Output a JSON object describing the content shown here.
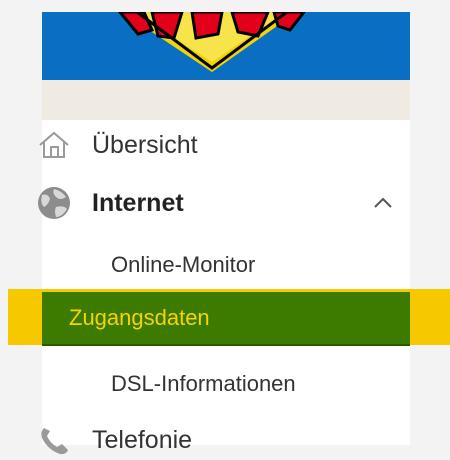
{
  "nav": {
    "overview_label": "Übersicht",
    "internet_label": "Internet",
    "telephony_label": "Telefonie",
    "internet_sub": [
      {
        "label": "Online-Monitor"
      },
      {
        "label": "Zugangsdaten"
      },
      {
        "label": "DSL-Informationen"
      }
    ]
  },
  "icons": {
    "overview": "home-icon",
    "internet": "globe-icon",
    "internet_toggle": "chevron-up-icon",
    "telephony": "phone-icon"
  },
  "colors": {
    "header_blue": "#0a6fc2",
    "active_bg": "#3d7a00",
    "active_text": "#f5d400",
    "highlight": "#f5c800"
  }
}
